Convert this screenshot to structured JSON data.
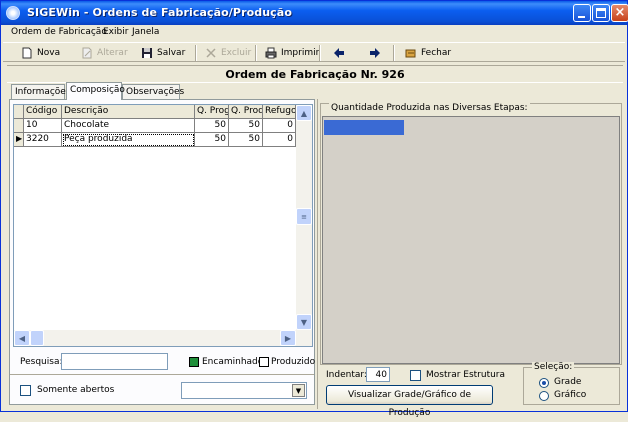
{
  "window": {
    "title": "SIGEWin - Ordens de Fabricação/Produção",
    "titlebar_color": "#0a50d6"
  },
  "menu": [
    {
      "label": "Ordem de Fabricação"
    },
    {
      "label": "Exibir"
    },
    {
      "label": "Janela"
    }
  ],
  "toolbar": {
    "nova": "Nova",
    "alterar": "Alterar",
    "salvar": "Salvar",
    "excluir": "Excluir",
    "imprimir": "Imprimir",
    "fechar": "Fechar",
    "icons": [
      "new-doc-icon",
      "edit-icon",
      "floppy-disk-icon",
      "delete-x-icon",
      "printer-icon",
      "arrow-left-icon",
      "arrow-right-icon",
      "close-door-icon"
    ]
  },
  "header": {
    "title": "Ordem de Fabricação Nr. 926"
  },
  "tabs": [
    {
      "label": "Informações"
    },
    {
      "label": "Composição"
    },
    {
      "label": "Observações"
    }
  ],
  "grid": {
    "columns": [
      "Código",
      "Descrição",
      "Q. Prog",
      "Q. Prod",
      "Refugo"
    ],
    "rows": [
      {
        "codigo": "10",
        "descricao": "Chocolate",
        "qprog": "50",
        "qprod": "50",
        "refugo": "0"
      },
      {
        "codigo": "3220",
        "descricao": "Peça produzida",
        "qprog": "50",
        "qprod": "50",
        "refugo": "0"
      }
    ]
  },
  "search": {
    "label": "Pesquisa:",
    "value": ""
  },
  "legend": {
    "encaminhado": "Encaminhado",
    "produzido": "Produzido",
    "encaminhado_color": "#1f8f3a",
    "produzido_color": "#ffffff"
  },
  "filter": {
    "somente_abertos": "Somente abertos",
    "combo_value": ""
  },
  "chart": {
    "title": "Quantidade Produzida nas Diversas Etapas:",
    "bar_color": "#3a6ad4"
  },
  "chart_data": {
    "type": "bar",
    "categories": [
      ""
    ],
    "values": [
      1
    ]
  },
  "controls": {
    "indentar_label": "Indentar:",
    "indentar_value": "40",
    "mostrar_estrutura": "Mostrar Estrutura",
    "visualizar": "Visualizar Grade/Gráfico de Produção",
    "selecao_label": "Seleção:",
    "grade": "Grade",
    "grafico": "Gráfico"
  }
}
